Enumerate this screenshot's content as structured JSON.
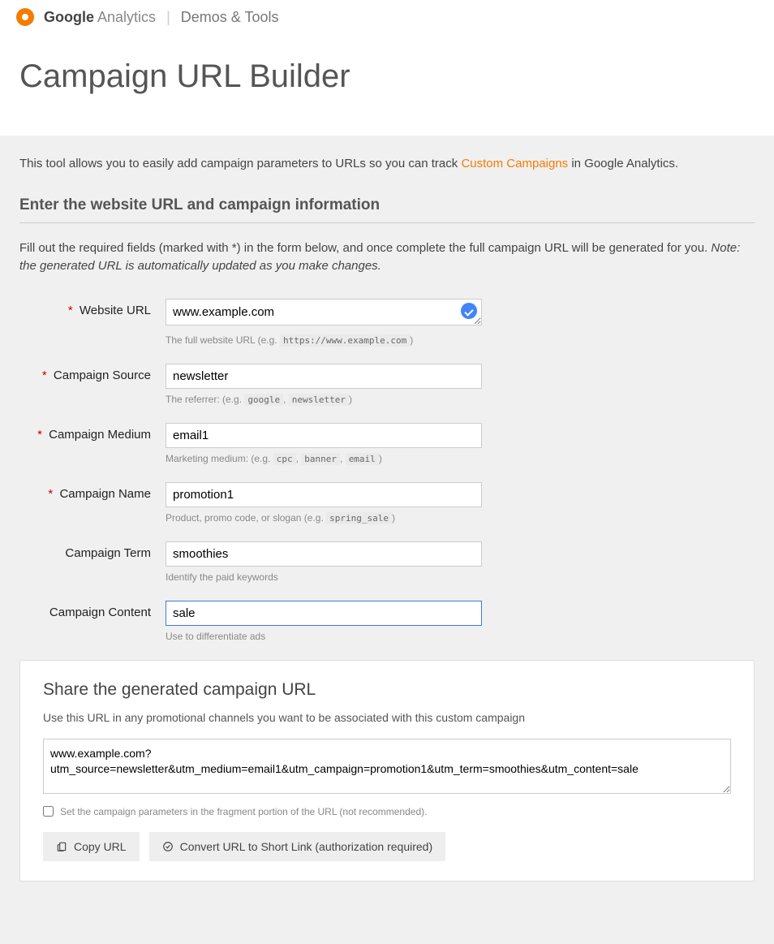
{
  "header": {
    "brand_bold": "Google",
    "brand_light": " Analytics",
    "separator": "|",
    "section": "Demos & Tools"
  },
  "page": {
    "title": "Campaign URL Builder",
    "intro_prefix": "This tool allows you to easily add campaign parameters to URLs so you can track ",
    "intro_link": "Custom Campaigns",
    "intro_suffix": " in Google Analytics.",
    "form_heading": "Enter the website URL and campaign information",
    "instructions_plain": "Fill out the required fields (marked with *) in the form below, and once complete the full campaign URL will be generated for you. ",
    "instructions_note": "Note: the generated URL is automatically updated as you make changes."
  },
  "fields": {
    "website_url": {
      "label": "Website URL",
      "required": true,
      "value": "www.example.com",
      "hint_prefix": "The full website URL (e.g. ",
      "hint_codes": [
        "https://www.example.com"
      ],
      "hint_separators": [
        ")"
      ],
      "valid": true
    },
    "campaign_source": {
      "label": "Campaign Source",
      "required": true,
      "value": "newsletter",
      "hint_prefix": "The referrer: (e.g. ",
      "hint_codes": [
        "google",
        "newsletter"
      ],
      "hint_separators": [
        ", ",
        ")"
      ]
    },
    "campaign_medium": {
      "label": "Campaign Medium",
      "required": true,
      "value": "email1",
      "hint_prefix": "Marketing medium: (e.g. ",
      "hint_codes": [
        "cpc",
        "banner",
        "email"
      ],
      "hint_separators": [
        ", ",
        ", ",
        ")"
      ]
    },
    "campaign_name": {
      "label": "Campaign Name",
      "required": true,
      "value": "promotion1",
      "hint_prefix": "Product, promo code, or slogan (e.g. ",
      "hint_codes": [
        "spring_sale"
      ],
      "hint_separators": [
        ")"
      ]
    },
    "campaign_term": {
      "label": "Campaign Term",
      "required": false,
      "value": "smoothies",
      "hint_text": "Identify the paid keywords"
    },
    "campaign_content": {
      "label": "Campaign Content",
      "required": false,
      "value": "sale",
      "hint_text": "Use to differentiate ads",
      "focused": true
    }
  },
  "share": {
    "heading": "Share the generated campaign URL",
    "subheading": "Use this URL in any promotional channels you want to be associated with this custom campaign",
    "generated_url": "www.example.com?utm_source=newsletter&utm_medium=email1&utm_campaign=promotion1&utm_term=smoothies&utm_content=sale",
    "fragment_checkbox_label": "Set the campaign parameters in the fragment portion of the URL (not recommended).",
    "fragment_checked": false,
    "copy_button": "Copy URL",
    "shorten_button": "Convert URL to Short Link (authorization required)"
  }
}
